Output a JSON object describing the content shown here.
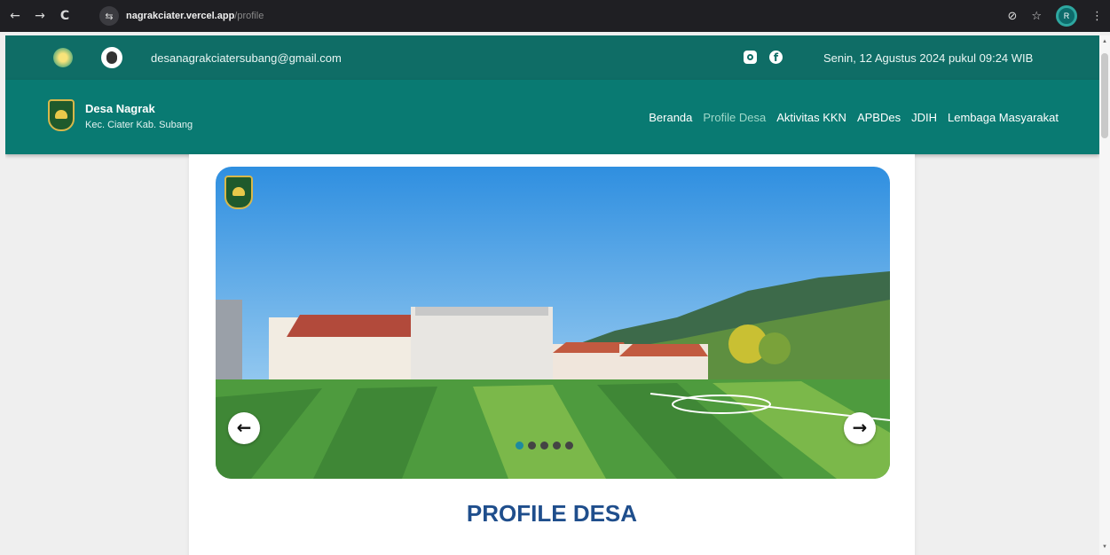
{
  "browser": {
    "back": "←",
    "forward": "→",
    "reload": "C",
    "url_host": "nagrakciater.vercel.app",
    "url_path": "/profile",
    "profile_initial": "R"
  },
  "topbar": {
    "email": "desanagrakciatersubang@gmail.com",
    "date": "Senin, 12 Agustus 2024 pukul 09:24 WIB"
  },
  "brand": {
    "title": "Desa Nagrak",
    "subtitle": "Kec. Ciater Kab. Subang"
  },
  "nav": {
    "items": [
      {
        "label": "Beranda"
      },
      {
        "label": "Profile Desa"
      },
      {
        "label": "Aktivitas KKN"
      },
      {
        "label": "APBDes"
      },
      {
        "label": "JDIH"
      },
      {
        "label": "Lembaga Masyarakat"
      }
    ],
    "active_index": 1
  },
  "carousel": {
    "prev": "←",
    "next": "→",
    "slide_count": 5,
    "active_slide": 0
  },
  "content": {
    "heading": "PROFILE DESA"
  },
  "colors": {
    "topbar": "#0f6d66",
    "nav": "#097a72",
    "heading": "#1f4e8c",
    "active_nav": "#9fd8c9"
  }
}
